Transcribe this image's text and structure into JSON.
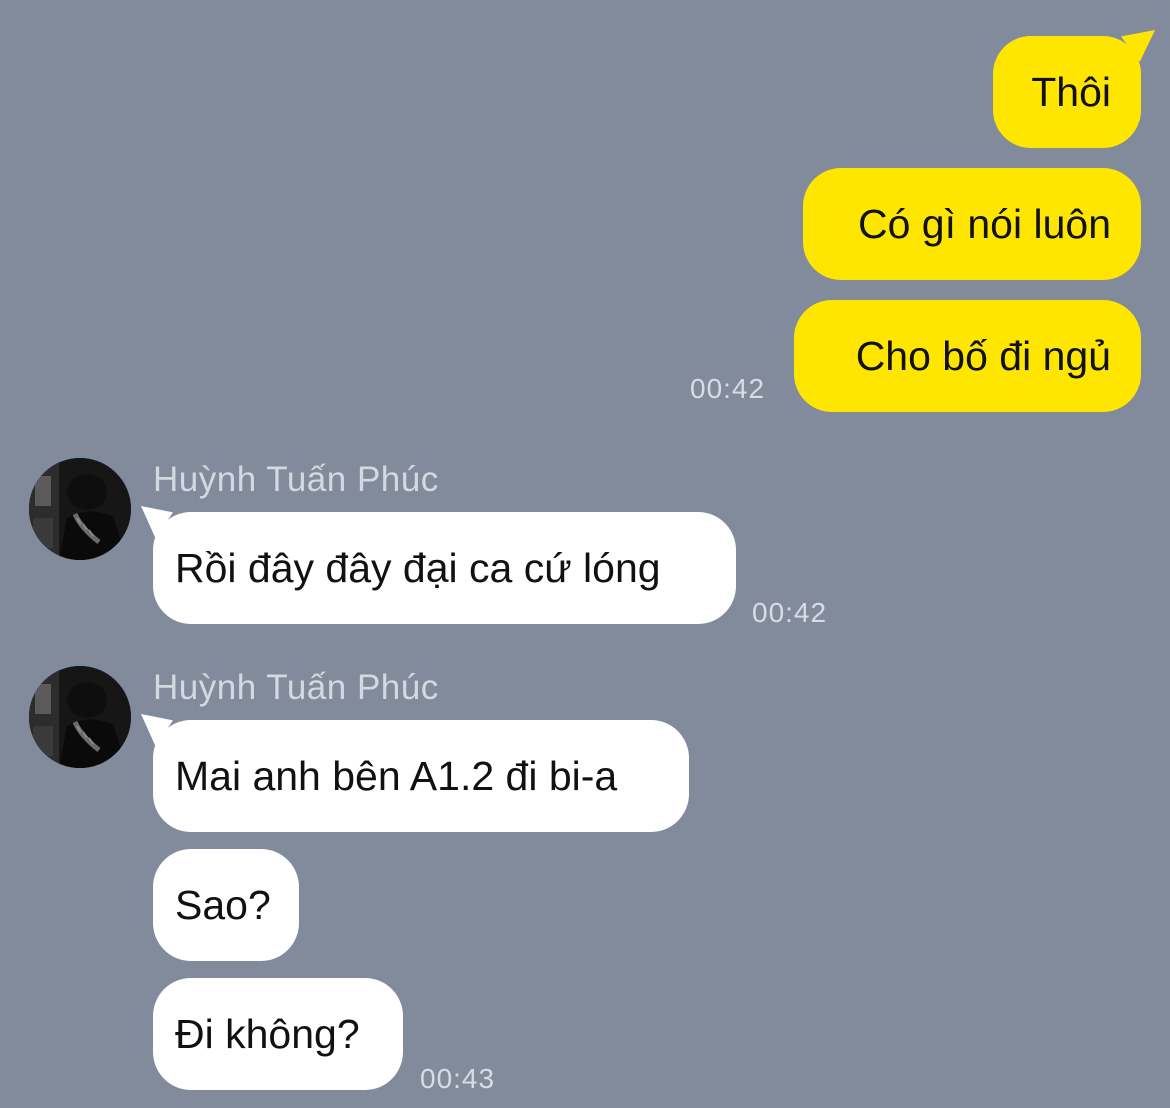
{
  "colors": {
    "background": "#828b9b",
    "outgoing_bubble": "#ffe600",
    "incoming_bubble": "#ffffff",
    "timestamp": "#d8dce4",
    "sender_name": "#d4d8e0"
  },
  "outgoing": {
    "messages": [
      {
        "text": "Thôi"
      },
      {
        "text": "Có gì nói luôn"
      },
      {
        "text": "Cho bố đi ngủ"
      }
    ],
    "time": "00:42"
  },
  "incoming_group_1": {
    "sender": "Huỳnh Tuấn Phúc",
    "avatar_icon": "profile-photo-avatar",
    "messages": [
      {
        "text": "Rồi đây đây đại ca cứ lóng"
      }
    ],
    "time": "00:42"
  },
  "incoming_group_2": {
    "sender": "Huỳnh Tuấn Phúc",
    "avatar_icon": "profile-photo-avatar",
    "messages": [
      {
        "text": "Mai anh bên A1.2 đi bi-a"
      },
      {
        "text": "Sao?"
      },
      {
        "text": "Đi không?"
      }
    ],
    "time": "00:43"
  }
}
